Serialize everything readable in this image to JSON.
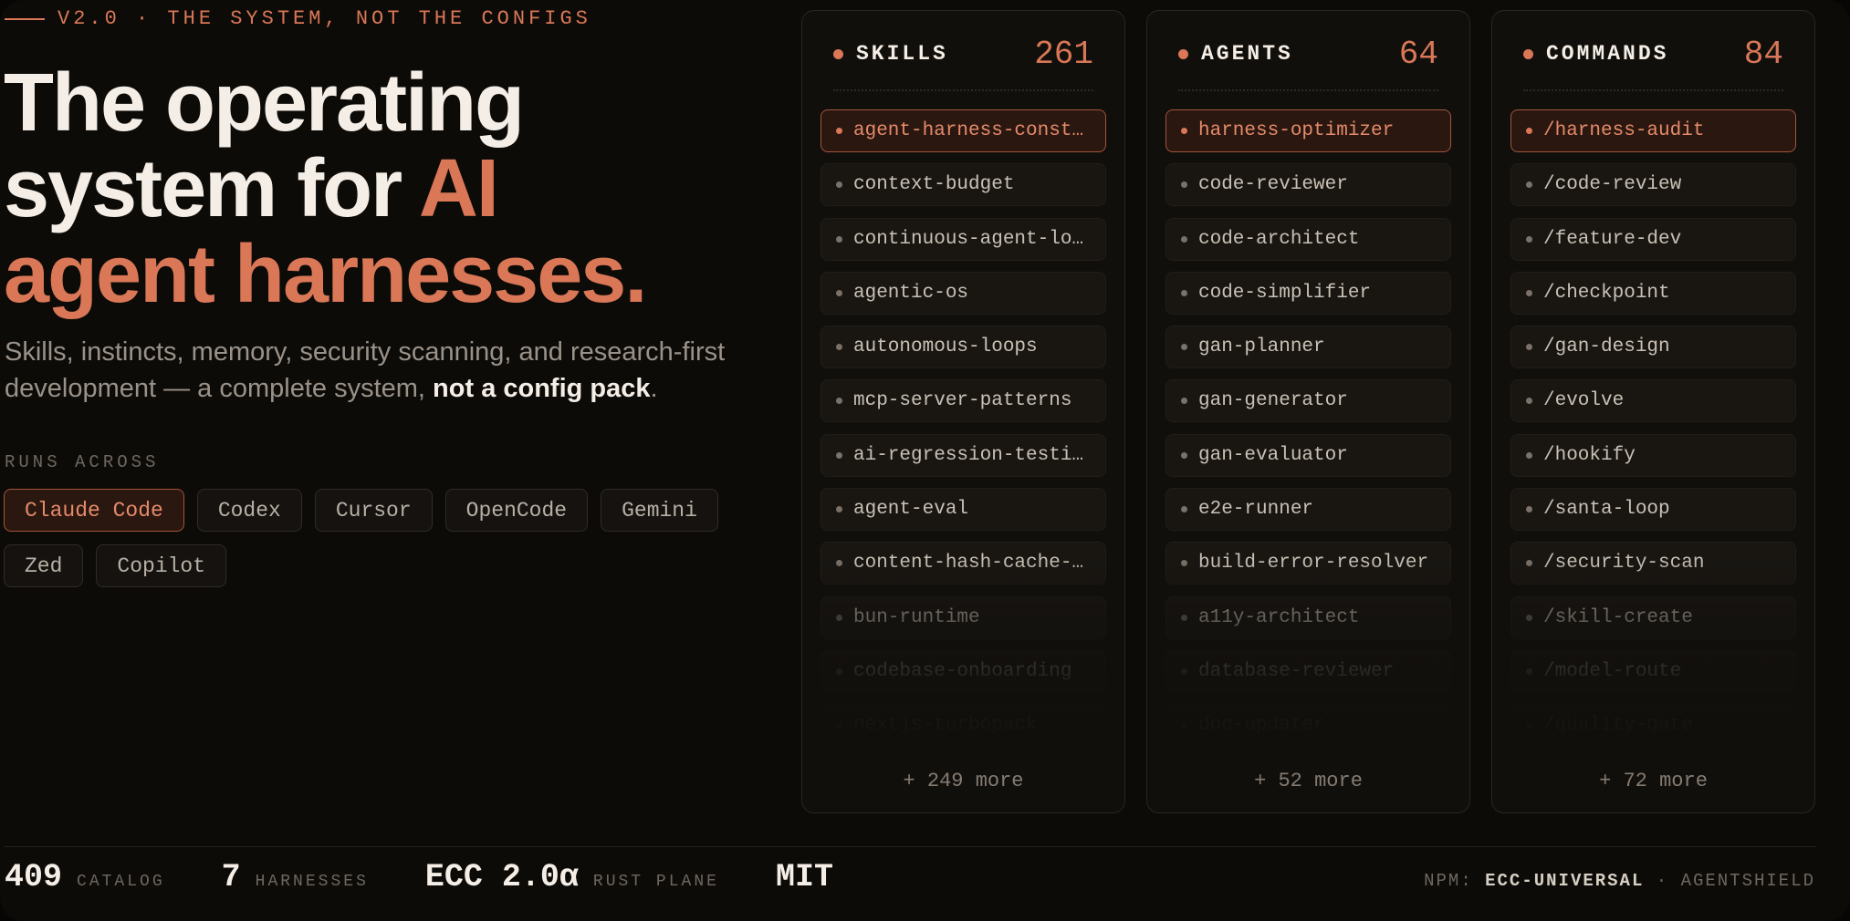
{
  "hero": {
    "eyebrow": "V2.0 · THE SYSTEM, NOT THE CONFIGS",
    "headline_line1": "The operating",
    "headline_line2a": "system for ",
    "headline_line2b": "AI",
    "headline_line3": "agent harnesses.",
    "subtitle_main": "Skills, instincts, memory, security scanning, and research-first development — a complete system, ",
    "subtitle_bold": "not a config pack",
    "subtitle_end": ".",
    "runs_label": "RUNS ACROSS",
    "harnesses": [
      "Claude Code",
      "Codex",
      "Cursor",
      "OpenCode",
      "Gemini",
      "Zed",
      "Copilot"
    ],
    "active_harness": "Claude Code"
  },
  "panels": [
    {
      "title": "SKILLS",
      "count": "261",
      "items": [
        "agent-harness-constr…",
        "context-budget",
        "continuous-agent-loop",
        "agentic-os",
        "autonomous-loops",
        "mcp-server-patterns",
        "ai-regression-testing",
        "agent-eval",
        "content-hash-cache-p…",
        "bun-runtime",
        "codebase-onboarding",
        "nextjs-turbopack"
      ],
      "more": "+ 249 more"
    },
    {
      "title": "AGENTS",
      "count": "64",
      "items": [
        "harness-optimizer",
        "code-reviewer",
        "code-architect",
        "code-simplifier",
        "gan-planner",
        "gan-generator",
        "gan-evaluator",
        "e2e-runner",
        "build-error-resolver",
        "a11y-architect",
        "database-reviewer",
        "doc-updater"
      ],
      "more": "+ 52 more"
    },
    {
      "title": "COMMANDS",
      "count": "84",
      "items": [
        "/harness-audit",
        "/code-review",
        "/feature-dev",
        "/checkpoint",
        "/gan-design",
        "/evolve",
        "/hookify",
        "/santa-loop",
        "/security-scan",
        "/skill-create",
        "/model-route",
        "/quality-gate"
      ],
      "more": "+ 72 more"
    }
  ],
  "footer": {
    "stats": [
      {
        "value": "409",
        "label": "CATALOG"
      },
      {
        "value": "7",
        "label": "HARNESSES"
      },
      {
        "value": "ECC 2.0α",
        "label": "RUST PLANE"
      },
      {
        "value": "MIT",
        "label": ""
      }
    ],
    "npm_label": "NPM: ",
    "npm_package": "ECC-UNIVERSAL",
    "separator": " · ",
    "agentshield": "AGENTSHIELD"
  },
  "colors": {
    "accent": "#d97757",
    "background": "#0d0b08",
    "text": "#f4eee6",
    "muted": "#9a9289"
  }
}
